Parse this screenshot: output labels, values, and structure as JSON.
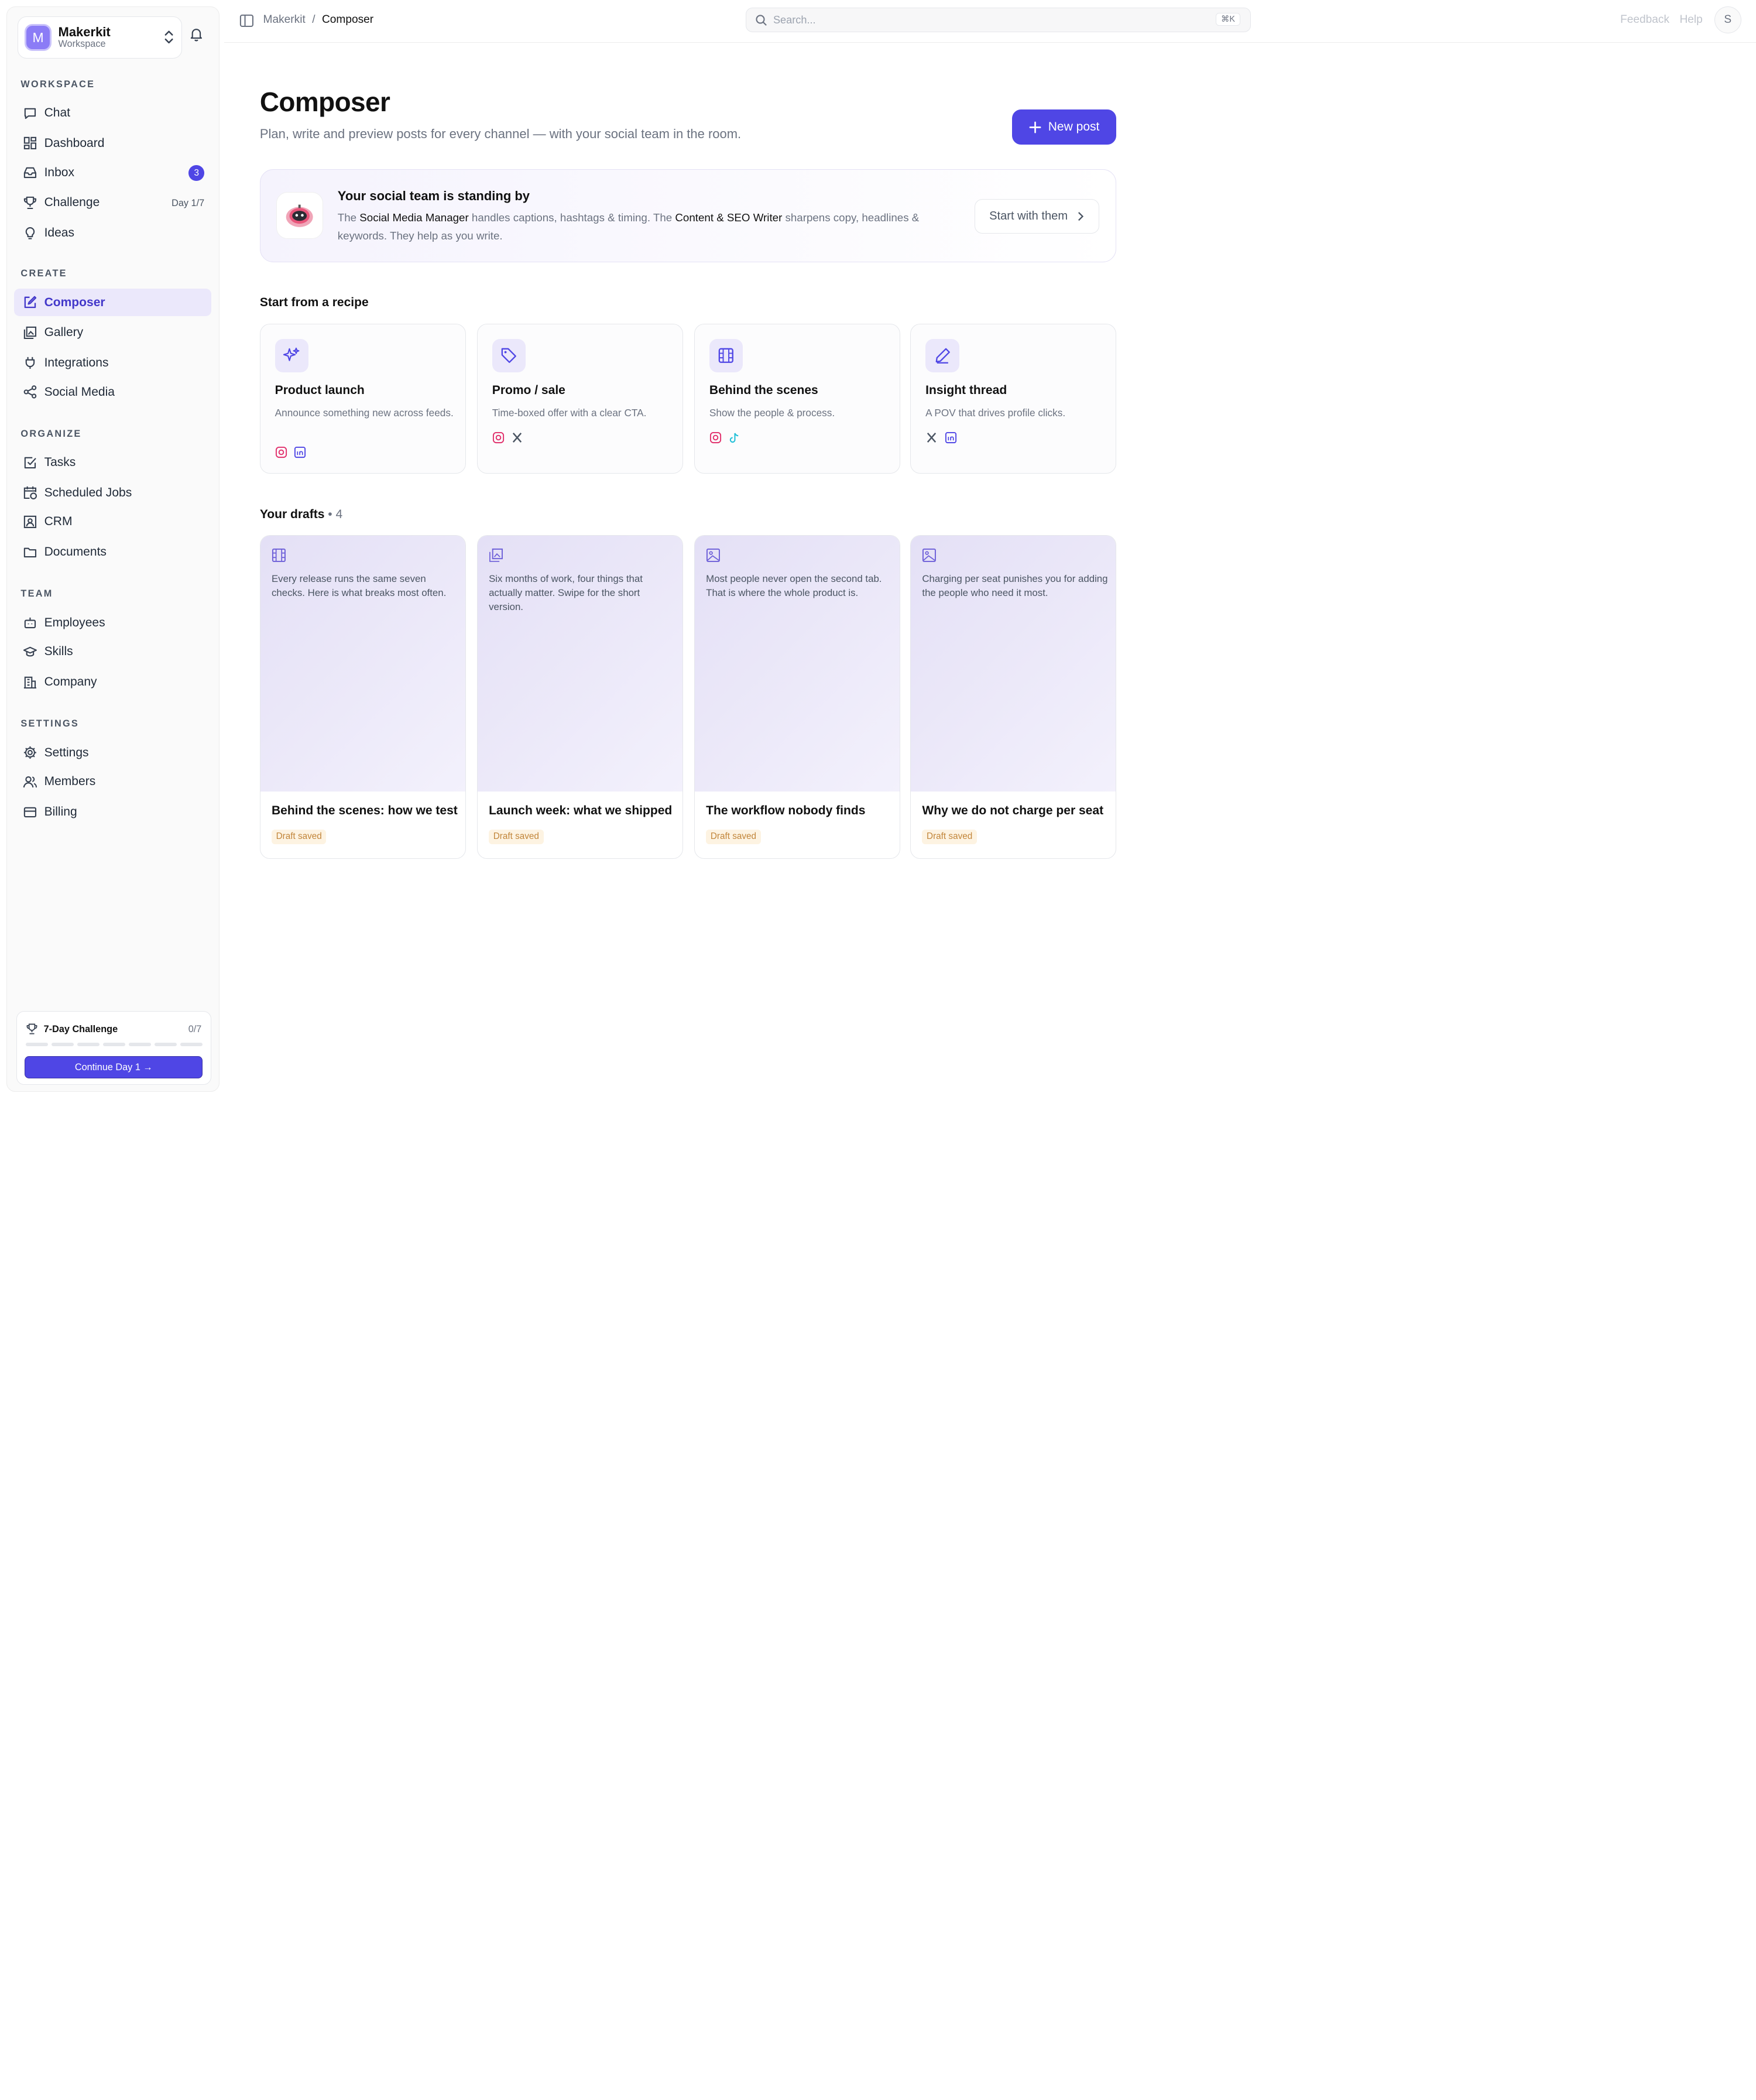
{
  "colors": {
    "accent": "#4f46e5",
    "accent_soft": "#ebe8fb",
    "draft_badge": "#c2853a"
  },
  "workspace": {
    "initial": "M",
    "name": "Makerkit",
    "subtitle": "Workspace"
  },
  "sidebar": {
    "sections": [
      {
        "label": "WORKSPACE",
        "items": [
          {
            "label": "Chat",
            "icon": "chat-icon"
          },
          {
            "label": "Dashboard",
            "icon": "dashboard-icon"
          },
          {
            "label": "Inbox",
            "icon": "inbox-icon",
            "badge": "3"
          },
          {
            "label": "Challenge",
            "icon": "trophy-icon",
            "meta": "Day 1/7"
          },
          {
            "label": "Ideas",
            "icon": "lightbulb-icon"
          }
        ]
      },
      {
        "label": "CREATE",
        "items": [
          {
            "label": "Composer",
            "icon": "compose-icon",
            "active": true
          },
          {
            "label": "Gallery",
            "icon": "gallery-icon"
          },
          {
            "label": "Integrations",
            "icon": "plug-icon"
          },
          {
            "label": "Social Media",
            "icon": "share-icon"
          }
        ]
      },
      {
        "label": "ORGANIZE",
        "items": [
          {
            "label": "Tasks",
            "icon": "checkbox-icon"
          },
          {
            "label": "Scheduled Jobs",
            "icon": "calendar-clock-icon"
          },
          {
            "label": "CRM",
            "icon": "contact-icon"
          },
          {
            "label": "Documents",
            "icon": "folder-icon"
          }
        ]
      },
      {
        "label": "TEAM",
        "items": [
          {
            "label": "Employees",
            "icon": "bot-icon"
          },
          {
            "label": "Skills",
            "icon": "graduation-cap-icon"
          },
          {
            "label": "Company",
            "icon": "building-icon"
          }
        ]
      },
      {
        "label": "SETTINGS",
        "items": [
          {
            "label": "Settings",
            "icon": "gear-icon"
          },
          {
            "label": "Members",
            "icon": "users-icon"
          },
          {
            "label": "Billing",
            "icon": "credit-card-icon"
          }
        ]
      }
    ],
    "challenge": {
      "title": "7-Day Challenge",
      "count": "0/7",
      "progress": 0,
      "button": "Continue Day 1 →"
    }
  },
  "topbar": {
    "breadcrumb": [
      "Makerkit",
      "Composer"
    ],
    "search_placeholder": "Search...",
    "search_shortcut": "⌘K",
    "feedback": "Feedback",
    "help": "Help",
    "avatar_initial": "S"
  },
  "main": {
    "title": "Composer",
    "subtitle": "Plan, write and preview posts for every channel — with your social team in the room.",
    "new_post_label": "New post",
    "banner": {
      "title": "Your social team is standing by",
      "desc_1": "The ",
      "role_1": "Social Media Manager",
      "desc_2": " handles captions, hashtags & timing. The ",
      "role_2": "Content & SEO Writer",
      "desc_3": " sharpens copy, headlines & keywords. They help as you write.",
      "button": "Start with them"
    },
    "recipes_heading": "Start from a recipe",
    "recipes": [
      {
        "title": "Product launch",
        "desc": "Announce something new across feeds.",
        "icon": "sparkles-icon",
        "platforms": [
          "instagram",
          "linkedin"
        ]
      },
      {
        "title": "Promo / sale",
        "desc": "Time-boxed offer with a clear CTA.",
        "icon": "tag-icon",
        "platforms": [
          "instagram",
          "x"
        ]
      },
      {
        "title": "Behind the scenes",
        "desc": "Show the people & process.",
        "icon": "film-icon",
        "platforms": [
          "instagram",
          "tiktok"
        ]
      },
      {
        "title": "Insight thread",
        "desc": "A POV that drives profile clicks.",
        "icon": "pen-icon",
        "platforms": [
          "x",
          "linkedin"
        ]
      }
    ],
    "drafts_heading": "Your drafts",
    "drafts_count": "• 4",
    "drafts": [
      {
        "icon": "film-icon",
        "text": "Every release runs the same seven checks. Here is what breaks most often.",
        "title": "Behind the scenes: how we test",
        "status": "Draft saved"
      },
      {
        "icon": "images-icon",
        "text": "Six months of work, four things that actually matter. Swipe for the short version.",
        "title": "Launch week: what we shipped",
        "status": "Draft saved"
      },
      {
        "icon": "image-icon",
        "text": "Most people never open the second tab. That is where the whole product is.",
        "title": "The workflow nobody finds",
        "status": "Draft saved"
      },
      {
        "icon": "image-icon",
        "text": "Charging per seat punishes you for adding the people who need it most.",
        "title": "Why we do not charge per seat",
        "status": "Draft saved"
      }
    ]
  }
}
